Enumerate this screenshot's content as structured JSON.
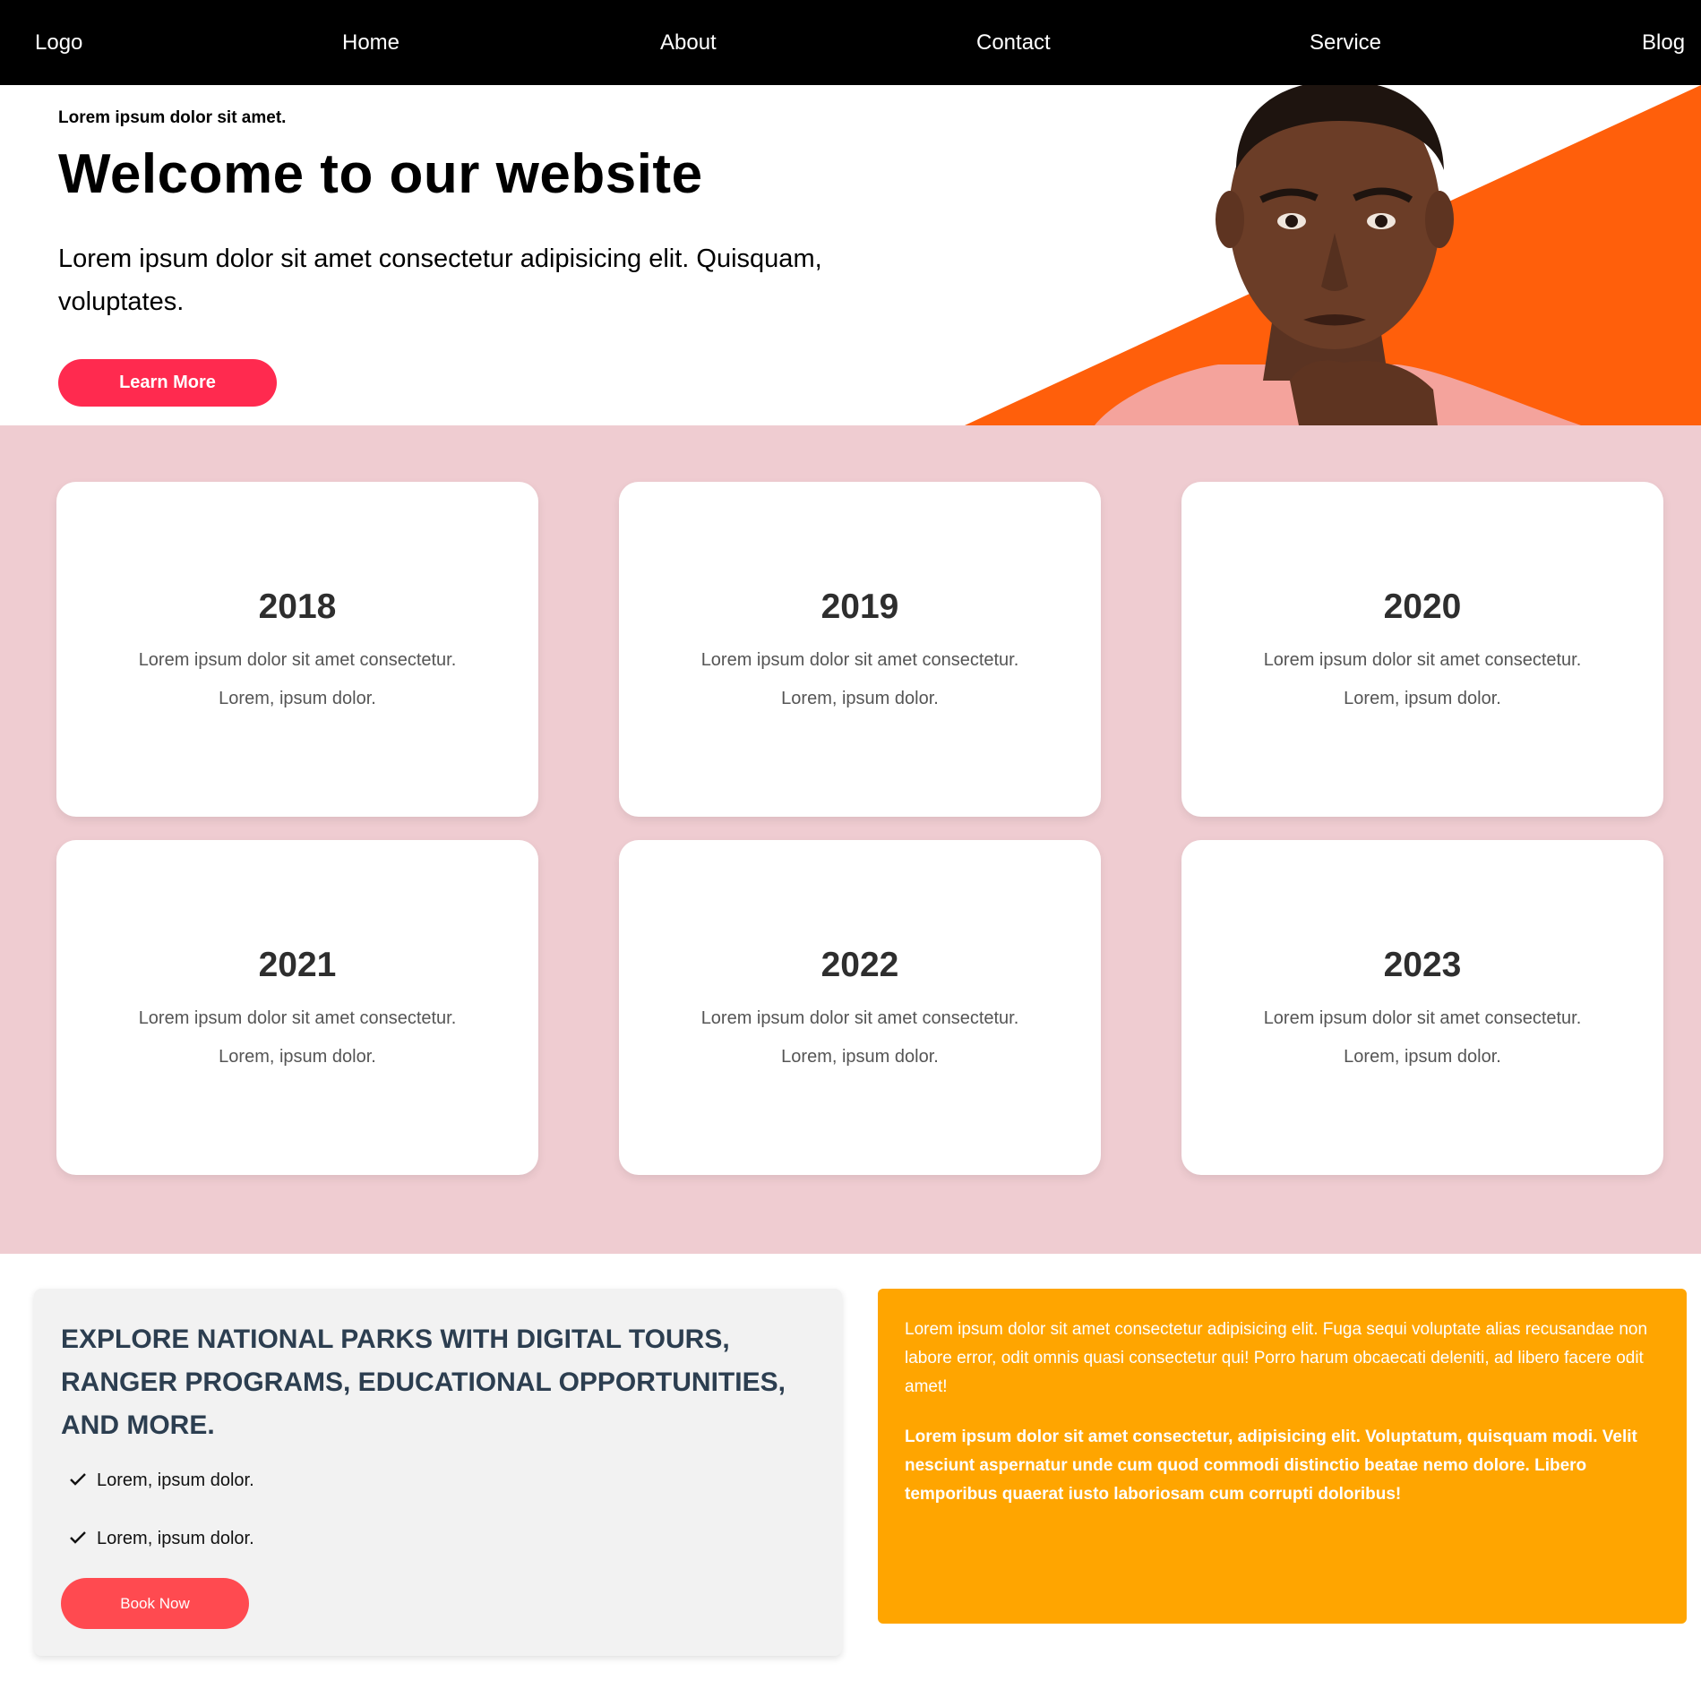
{
  "nav": {
    "logo": "Logo",
    "links": [
      "Home",
      "About",
      "Contact",
      "Service",
      "Blog"
    ]
  },
  "hero": {
    "kicker": "Lorem ipsum dolor sit amet.",
    "title": "Welcome to our website",
    "text": "Lorem ipsum dolor sit amet consectetur adipisicing elit. Quisquam, voluptates.",
    "button": "Learn More",
    "accent_color": "#ff5f0b"
  },
  "cards": [
    {
      "year": "2018",
      "line1": "Lorem ipsum dolor sit amet consectetur.",
      "line2": "Lorem, ipsum dolor."
    },
    {
      "year": "2019",
      "line1": "Lorem ipsum dolor sit amet consectetur.",
      "line2": "Lorem, ipsum dolor."
    },
    {
      "year": "2020",
      "line1": "Lorem ipsum dolor sit amet consectetur.",
      "line2": "Lorem, ipsum dolor."
    },
    {
      "year": "2021",
      "line1": "Lorem ipsum dolor sit amet consectetur.",
      "line2": "Lorem, ipsum dolor."
    },
    {
      "year": "2022",
      "line1": "Lorem ipsum dolor sit amet consectetur.",
      "line2": "Lorem, ipsum dolor."
    },
    {
      "year": "2023",
      "line1": "Lorem ipsum dolor sit amet consectetur.",
      "line2": "Lorem, ipsum dolor."
    }
  ],
  "explore": {
    "title": "EXPLORE NATIONAL PARKS WITH DIGITAL TOURS, RANGER PROGRAMS, EDUCATIONAL OPPORTUNITIES, AND MORE.",
    "items": [
      "Lorem, ipsum dolor.",
      "Lorem, ipsum dolor."
    ],
    "button": "Book Now",
    "check_icon": "check-icon"
  },
  "info": {
    "paragraph1": "Lorem ipsum dolor sit amet consectetur adipisicing elit. Fuga sequi voluptate alias recusandae non labore error, odit omnis quasi consectetur qui! Porro harum obcaecati deleniti, ad libero facere odit amet!",
    "paragraph2": "Lorem ipsum dolor sit amet consectetur, adipisicing elit. Voluptatum, quisquam modi. Velit nesciunt aspernatur unde cum quod commodi distinctio beatae nemo dolore. Libero temporibus quaerat iusto laboriosam cum corrupti doloribus!"
  },
  "colors": {
    "nav_bg": "#000000",
    "hero_button": "#ff2a4f",
    "cards_bg": "#efccd1",
    "explore_title": "#2c3e50",
    "book_button": "#ff4a50",
    "info_box": "#ffa500"
  }
}
